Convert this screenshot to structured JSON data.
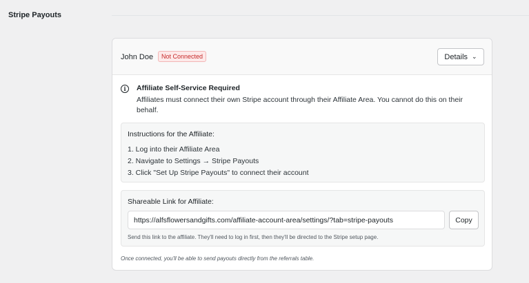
{
  "section": {
    "label": "Stripe Payouts"
  },
  "account": {
    "name": "John Doe",
    "status": "Not Connected",
    "details_label": "Details"
  },
  "notice": {
    "icon": "info-icon",
    "title": "Affiliate Self-Service Required",
    "body": "Affiliates must connect their own Stripe account through their Affiliate Area. You cannot do this on their behalf."
  },
  "instructions": {
    "title": "Instructions for the Affiliate:",
    "steps": [
      "1.  Log into their Affiliate Area",
      "2.  Navigate to Settings → Stripe Payouts",
      "3.  Click \"Set Up Stripe Payouts\" to connect their account"
    ]
  },
  "share": {
    "title": "Shareable Link for Affiliate:",
    "link": "https://alfsflowersandgifts.com/affiliate-account-area/settings/?tab=stripe-payouts",
    "copy_label": "Copy",
    "helper": "Send this link to the affiliate. They'll need to log in first, then they'll be directed to the Stripe setup page."
  },
  "footer_note": "Once connected, you'll be able to send payouts directly from the referrals table.",
  "colors": {
    "badge_text": "#c62a2a",
    "badge_bg": "#fde9e9",
    "page_bg": "#f0f0f1"
  }
}
